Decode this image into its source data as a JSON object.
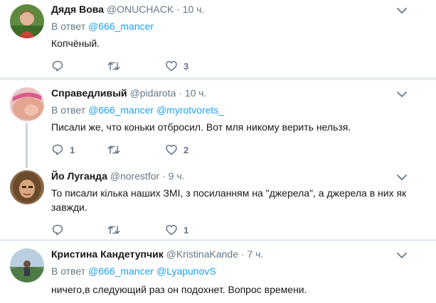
{
  "tweets": [
    {
      "name": "Дядя Вова",
      "handle": "@ONUCHACK",
      "time": "10 ч.",
      "reply_prefix": "В ответ",
      "mentions": "@666_mancer",
      "text": "Копчёный.",
      "counts": {
        "reply": "",
        "retweet": "",
        "like": "3"
      }
    },
    {
      "name": "Справедливый",
      "handle": "@pidarota",
      "time": "10 ч.",
      "reply_prefix": "В ответ",
      "mentions": "@666_mancer @myrotvorets_",
      "text": "Писали же, что коньки отбросил. Вот мля никому верить нельзя.",
      "counts": {
        "reply": "1",
        "retweet": "",
        "like": "2"
      }
    },
    {
      "name": "Йо Луганда",
      "handle": "@norestfor",
      "time": "9 ч.",
      "text": "То писали кілька наших ЗМІ, з посиланням на \"джерела\", а джерела в них як завжди.",
      "counts": {
        "reply": "",
        "retweet": "",
        "like": "1"
      }
    },
    {
      "name": "Кристина Кандетупчик",
      "handle": "@KristinaKande",
      "time": "7 ч.",
      "reply_prefix": "В ответ",
      "mentions": "@666_mancer @LyapunovS",
      "text": "ничего,в следующий раз он подохнет. Вопрос времени."
    }
  ],
  "separator": "·",
  "colors": {
    "accent": "#1da1f2",
    "muted": "#657786",
    "text": "#14171a",
    "background": "#e6ecf0",
    "card": "#ffffff"
  },
  "icons": [
    "avatar",
    "chevron-down-icon",
    "reply-icon",
    "retweet-icon",
    "like-icon"
  ]
}
